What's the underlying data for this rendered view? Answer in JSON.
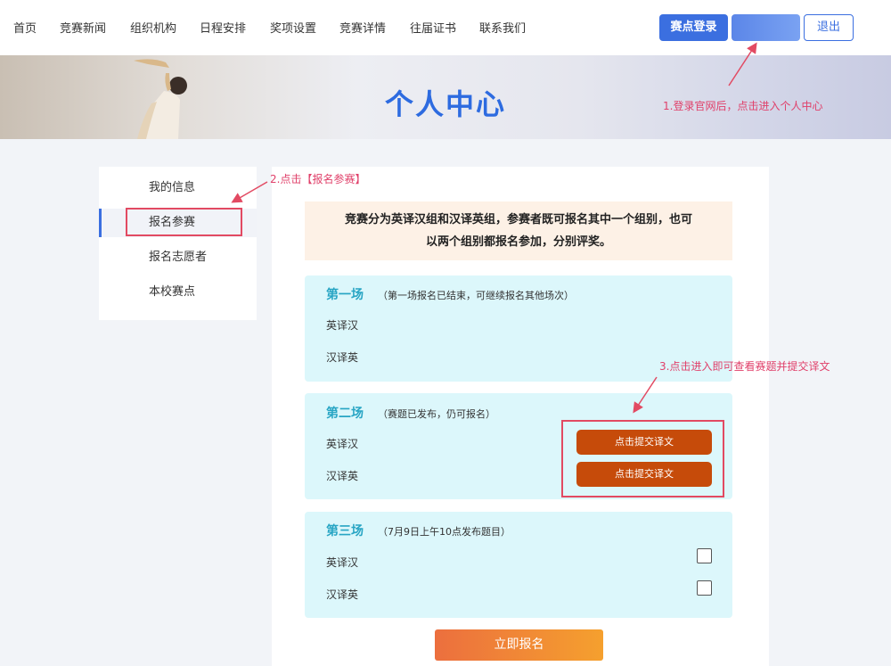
{
  "nav": {
    "items": [
      "首页",
      "竞赛新闻",
      "组织机构",
      "日程安排",
      "奖项设置",
      "竞赛详情",
      "往届证书",
      "联系我们"
    ],
    "login_label": "赛点登录",
    "profile_label": "",
    "logout_label": "退出"
  },
  "banner": {
    "title": "个人中心"
  },
  "sidebar": {
    "items": [
      "我的信息",
      "报名参赛",
      "报名志愿者",
      "本校赛点"
    ],
    "active": "报名参赛"
  },
  "notice": {
    "line1": "竞赛分为英译汉组和汉译英组，参赛者既可报名其中一个组别，也可",
    "line2": "以两个组别都报名参加，分别评奖。"
  },
  "sessions": [
    {
      "title": "第一场",
      "note": "（第一场报名已结束，可继续报名其他场次）",
      "rows": [
        "英译汉",
        "汉译英"
      ]
    },
    {
      "title": "第二场",
      "note": "（赛题已发布，仍可报名）",
      "rows": [
        "英译汉",
        "汉译英"
      ],
      "button_label": "点击提交译文"
    },
    {
      "title": "第三场",
      "note": "（7月9日上午10点发布题目）",
      "rows": [
        "英译汉",
        "汉译英"
      ]
    }
  ],
  "register_label": "立即报名",
  "annotations": {
    "step1": "1.登录官网后，点击进入个人中心",
    "step2": "2.点击【报名参赛】",
    "step3": "3.点击进入即可查看赛题并提交译文"
  },
  "colors": {
    "accent": "#3b6fe0",
    "submit": "#c64b0a",
    "annotation": "#e0406a",
    "session_bg": "#dcf7fb"
  }
}
